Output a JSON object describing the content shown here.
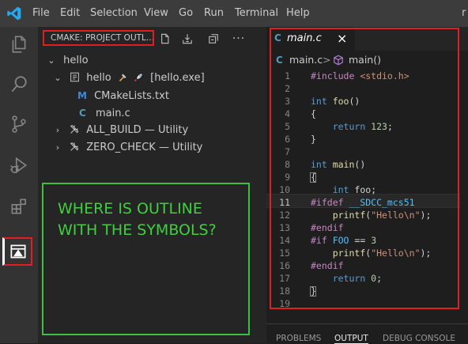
{
  "menubar": {
    "items": [
      "File",
      "Edit",
      "Selection",
      "View",
      "Go",
      "Run",
      "Terminal",
      "Help"
    ],
    "overflow_char": "r",
    "accent": "#23a9f2"
  },
  "activity_bar": {
    "icons": [
      "explorer-icon",
      "search-icon",
      "source-control-icon",
      "run-debug-icon",
      "extensions-icon",
      "cmake-icon"
    ],
    "highlight_color": "#e02020"
  },
  "sidebar": {
    "header_title": "CMAKE: PROJECT OUTL...",
    "tree": {
      "root": "hello",
      "project": {
        "label": "hello",
        "target": "[hello.exe]"
      },
      "files": [
        "CMakeLists.txt",
        "main.c"
      ],
      "utilities": [
        {
          "name": "ALL_BUILD",
          "sep": "—",
          "kind": "Utility"
        },
        {
          "name": "ZERO_CHECK",
          "sep": "—",
          "kind": "Utility"
        }
      ]
    },
    "note": "WHERE IS OUTLINE WITH THE SYMBOLS?",
    "note_color": "#3fcf3f"
  },
  "editor": {
    "tab": {
      "icon": "C",
      "label": "main.c",
      "close": "×"
    },
    "breadcrumb": {
      "file": "main.c",
      "sep": ">",
      "symbol": "main()"
    },
    "line_numbers": [
      "1",
      "2",
      "3",
      "4",
      "5",
      "6",
      "7",
      "8",
      "9",
      "10",
      "11",
      "12",
      "13",
      "14",
      "15",
      "16",
      "17",
      "18",
      "19"
    ],
    "code": {
      "l1_pp": "#include ",
      "l1_inc": "<stdio.h>",
      "l3_kw": "int ",
      "l3_fn": "foo",
      "l3_rest": "()",
      "l4": "{",
      "l5_kw": "return ",
      "l5_num": "123",
      "l5_rest": ";",
      "l6": "}",
      "l8_kw": "int ",
      "l8_fn": "main",
      "l8_rest": "()",
      "l9": "{",
      "l10_kw": "int ",
      "l10_rest": "foo;",
      "l11_pp": "#ifdef ",
      "l11_mac": "__SDCC_mcs51",
      "l12_fn": "printf",
      "l12_open": "(",
      "l12_str": "\"Hello\\n\"",
      "l12_close": ");",
      "l13_pp": "#endif",
      "l14_pp": "#if ",
      "l14_mac": "FOO",
      "l14_rest": " == ",
      "l14_num": "3",
      "l15_fn": "printf",
      "l15_open": "(",
      "l15_str": "\"Hello\\n\"",
      "l15_close": ");",
      "l16_pp": "#endif",
      "l17_kw": "return ",
      "l17_num": "0",
      "l17_rest": ";",
      "l18": "}"
    }
  },
  "panel": {
    "tabs": [
      "PROBLEMS",
      "OUTPUT",
      "DEBUG CONSOLE"
    ],
    "active": "OUTPUT"
  }
}
